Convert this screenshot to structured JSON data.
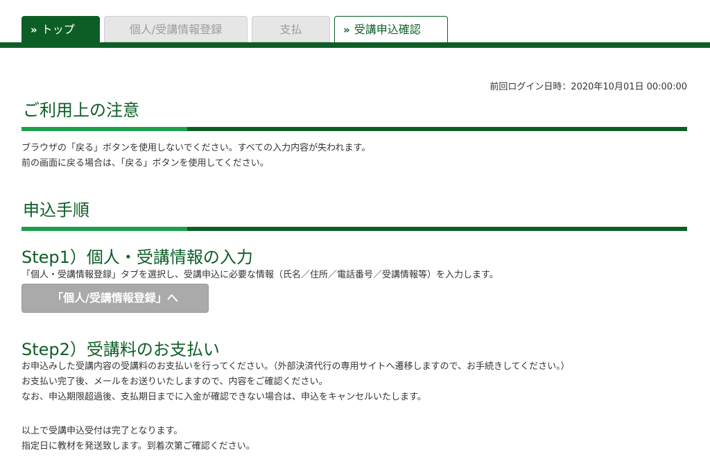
{
  "tabs": [
    {
      "label": "トップ",
      "state": "active"
    },
    {
      "label": "個人/受講情報登録",
      "state": "disabled"
    },
    {
      "label": "支払",
      "state": "disabled"
    },
    {
      "label": "受講申込確認",
      "state": "selectable"
    }
  ],
  "last_login": "前回ログイン日時：2020年10月01日 00:00:00",
  "notice": {
    "title": "ご利用上の注意",
    "lines": [
      "ブラウザの「戻る」ボタンを使用しないでください。すべての入力内容が失われます。",
      "前の画面に戻る場合は、「戻る」ボタンを使用してください。"
    ]
  },
  "procedure": {
    "title": "申込手順",
    "step1": {
      "title": "Step1）個人・受講情報の入力",
      "description": "「個人・受講情報登録」タブを選択し、受講申込に必要な情報（氏名／住所／電話番号／受講情報等）を入力します。",
      "button_label": "「個人/受講情報登録」へ"
    },
    "step2": {
      "title": "Step2）受講料のお支払い",
      "lines": [
        "お申込みした受講内容の受講料のお支払いを行ってください。（外部決済代行の専用サイトへ遷移しますので、お手続きしてください。）",
        "お支払い完了後、メールをお送りいたしますので、内容をご確認ください。",
        "なお、申込期限超過後、支払期日までに入金が確認できない場合は、申込をキャンセルいたします。"
      ]
    },
    "closing": [
      "以上で受講申込受付は完了となります。",
      "指定日に教材を発送致します。到着次第ご確認ください。"
    ]
  },
  "colors": {
    "brand_green": "#0d5e26",
    "accent_green": "#1aa14a",
    "disabled_gray": "#aaaaaa"
  }
}
